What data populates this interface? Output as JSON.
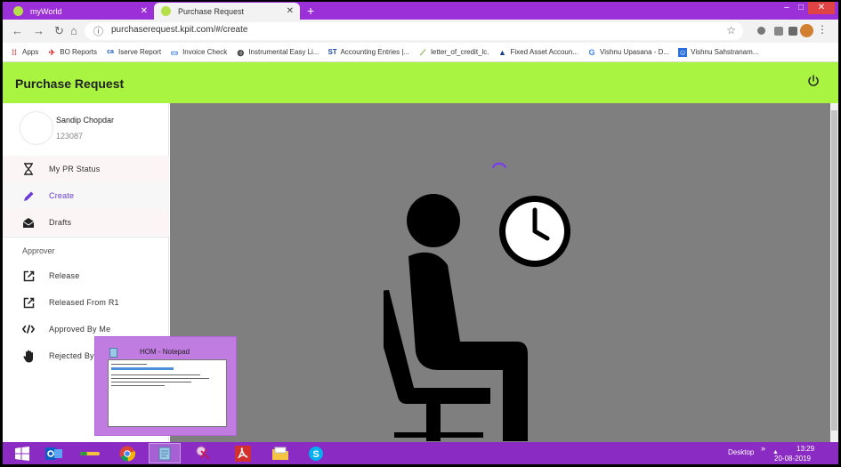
{
  "browser": {
    "tabs": [
      {
        "label": "myWorld",
        "close": "✕"
      },
      {
        "label": "Purchase Request",
        "close": "✕"
      }
    ],
    "new_tab": "+",
    "window_controls": {
      "minimize": "–",
      "maximize": "□",
      "close": "✕"
    },
    "url": "purchaserequest.kpit.com/#/create",
    "bookmarks": [
      {
        "label": "Apps",
        "icon": "apps-grid-icon"
      },
      {
        "label": "BO Reports",
        "icon": "bo-icon"
      },
      {
        "label": "Iserve Report",
        "icon": "ca-icon"
      },
      {
        "label": "Invoice Check",
        "icon": "invoice-icon"
      },
      {
        "label": "Instrumental Easy Li...",
        "icon": "globe-icon"
      },
      {
        "label": "Accounting Entries |...",
        "icon": "st-icon"
      },
      {
        "label": "letter_of_credit_lc.",
        "icon": "leaf-icon"
      },
      {
        "label": "Fixed Asset Accoun...",
        "icon": "arrow-icon"
      },
      {
        "label": "Vishnu Upasana - D...",
        "icon": "google-icon"
      },
      {
        "label": "Vishnu Sahstranam...",
        "icon": "person-icon"
      }
    ]
  },
  "app": {
    "title": "Purchase Request",
    "user": {
      "name": "Sandip Chopdar",
      "id": "123087"
    },
    "nav": [
      {
        "label": "My PR Status",
        "icon": "hourglass-icon"
      },
      {
        "label": "Create",
        "icon": "pencil-icon"
      },
      {
        "label": "Drafts",
        "icon": "envelope-open-icon"
      }
    ],
    "approver_header": "Approver",
    "approver_nav": [
      {
        "label": "Release",
        "icon": "open-in-new-icon"
      },
      {
        "label": "Released From R1",
        "icon": "open-in-new-icon"
      },
      {
        "label": "Approved By Me",
        "icon": "code-icon"
      },
      {
        "label": "Rejected By",
        "icon": "hand-icon"
      }
    ]
  },
  "taskbar": {
    "preview_title": "HOM - Notepad",
    "desktop_label": "Desktop",
    "chevrons": "»",
    "time": "13:29",
    "date": "20-08-2019"
  },
  "colors": {
    "tab_strip": "#9b30d9",
    "app_bar": "#a9f440",
    "active_nav": "#6a3bdc",
    "content_bg": "#7f7f7f",
    "taskbar": "#8a2bc4"
  }
}
